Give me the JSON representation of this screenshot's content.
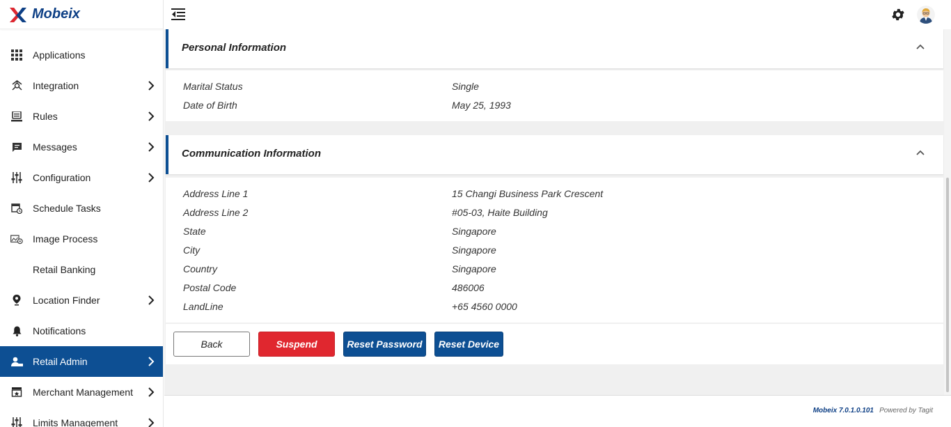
{
  "brand": {
    "name": "Mobeix",
    "accent": "#0d4f93",
    "danger": "#e0272f"
  },
  "sidebar": {
    "items": [
      {
        "label": "Applications",
        "icon": "grid-icon",
        "has_submenu": false,
        "active": false
      },
      {
        "label": "Integration",
        "icon": "integration-icon",
        "has_submenu": true,
        "active": false
      },
      {
        "label": "Rules",
        "icon": "rules-icon",
        "has_submenu": true,
        "active": false
      },
      {
        "label": "Messages",
        "icon": "message-icon",
        "has_submenu": true,
        "active": false
      },
      {
        "label": "Configuration",
        "icon": "sliders-icon",
        "has_submenu": true,
        "active": false
      },
      {
        "label": "Schedule Tasks",
        "icon": "calendar-clock-icon",
        "has_submenu": false,
        "active": false
      },
      {
        "label": "Image Process",
        "icon": "image-gear-icon",
        "has_submenu": false,
        "active": false
      },
      {
        "label": "Retail Banking",
        "icon": "",
        "has_submenu": false,
        "active": false
      },
      {
        "label": "Location Finder",
        "icon": "location-pin-icon",
        "has_submenu": true,
        "active": false
      },
      {
        "label": "Notifications",
        "icon": "bell-icon",
        "has_submenu": false,
        "active": false
      },
      {
        "label": "Retail Admin",
        "icon": "user-admin-icon",
        "has_submenu": true,
        "active": true
      },
      {
        "label": "Merchant Management",
        "icon": "store-icon",
        "has_submenu": true,
        "active": false
      },
      {
        "label": "Limits Management",
        "icon": "sliders-icon",
        "has_submenu": true,
        "active": false
      }
    ]
  },
  "personal": {
    "title": "Personal Information",
    "rows": [
      {
        "label": "Marital Status",
        "value": "Single"
      },
      {
        "label": "Date of Birth",
        "value": "May 25, 1993"
      }
    ]
  },
  "communication": {
    "title": "Communication Information",
    "rows": [
      {
        "label": "Address Line 1",
        "value": "15 Changi Business Park Crescent"
      },
      {
        "label": "Address Line 2",
        "value": "#05-03, Haite Building"
      },
      {
        "label": "State",
        "value": "Singapore"
      },
      {
        "label": "City",
        "value": "Singapore"
      },
      {
        "label": "Country",
        "value": "Singapore"
      },
      {
        "label": "Postal Code",
        "value": "486006"
      },
      {
        "label": "LandLine",
        "value": "+65 4560 0000"
      }
    ]
  },
  "actions": {
    "back": "Back",
    "suspend": "Suspend",
    "reset_password": "Reset Password",
    "reset_device": "Reset Device"
  },
  "footer": {
    "version": "Mobeix 7.0.1.0.101",
    "powered": "Powered by Tagit"
  }
}
